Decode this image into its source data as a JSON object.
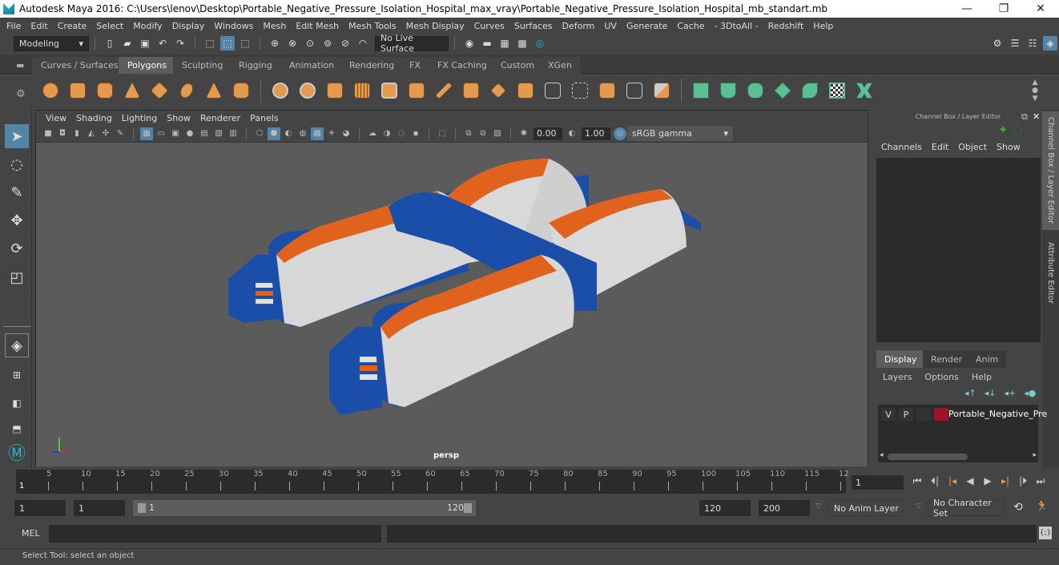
{
  "window": {
    "title": "Autodesk Maya 2016: C:\\Users\\lenov\\Desktop\\Portable_Negative_Pressure_Isolation_Hospital_max_vray\\Portable_Negative_Pressure_Isolation_Hospital_mb_standart.mb",
    "minimize": "—",
    "restore": "❐",
    "close": "✕"
  },
  "menu": [
    "File",
    "Edit",
    "Create",
    "Select",
    "Modify",
    "Display",
    "Windows",
    "Mesh",
    "Edit Mesh",
    "Mesh Tools",
    "Mesh Display",
    "Curves",
    "Surfaces",
    "Deform",
    "UV",
    "Generate",
    "Cache",
    "- 3DtoAll -",
    "Redshift",
    "Help"
  ],
  "statusline": {
    "mode": "Modeling",
    "live_surface": "No Live Surface"
  },
  "shelf": {
    "tabs": [
      "Curves / Surfaces",
      "Polygons",
      "Sculpting",
      "Rigging",
      "Animation",
      "Rendering",
      "FX",
      "FX Caching",
      "Custom",
      "XGen"
    ],
    "active": "Polygons"
  },
  "viewport": {
    "menu": [
      "View",
      "Shading",
      "Lighting",
      "Show",
      "Renderer",
      "Panels"
    ],
    "exposure": "0.00",
    "gamma": "1.00",
    "color_space": "sRGB gamma",
    "camera": "persp"
  },
  "channel_box": {
    "title": "Channel Box / Layer Editor",
    "menu": [
      "Channels",
      "Edit",
      "Object",
      "Show"
    ]
  },
  "side_tabs": [
    "Channel Box / Layer Editor",
    "Attribute Editor"
  ],
  "layer_editor": {
    "tabs": [
      "Display",
      "Render",
      "Anim"
    ],
    "active": "Display",
    "menu": [
      "Layers",
      "Options",
      "Help"
    ],
    "layers": [
      {
        "v": "V",
        "p": "P",
        "color": "#a0102a",
        "name": "Portable_Negative_Pre"
      }
    ]
  },
  "timeline": {
    "ticks": [
      "5",
      "10",
      "15",
      "20",
      "25",
      "30",
      "35",
      "40",
      "45",
      "50",
      "55",
      "60",
      "65",
      "70",
      "75",
      "80",
      "85",
      "90",
      "95",
      "100",
      "105",
      "110",
      "115",
      "12"
    ],
    "current_frame_marker": "1",
    "current_frame": "1"
  },
  "range": {
    "start": "1",
    "playback_start": "1",
    "slider_start": "1",
    "slider_end": "120",
    "playback_end": "120",
    "end": "200",
    "anim_layer": "No Anim Layer",
    "character_set": "No Character Set"
  },
  "command_line": {
    "label": "MEL"
  },
  "status": {
    "help": "Select Tool: select an object"
  }
}
